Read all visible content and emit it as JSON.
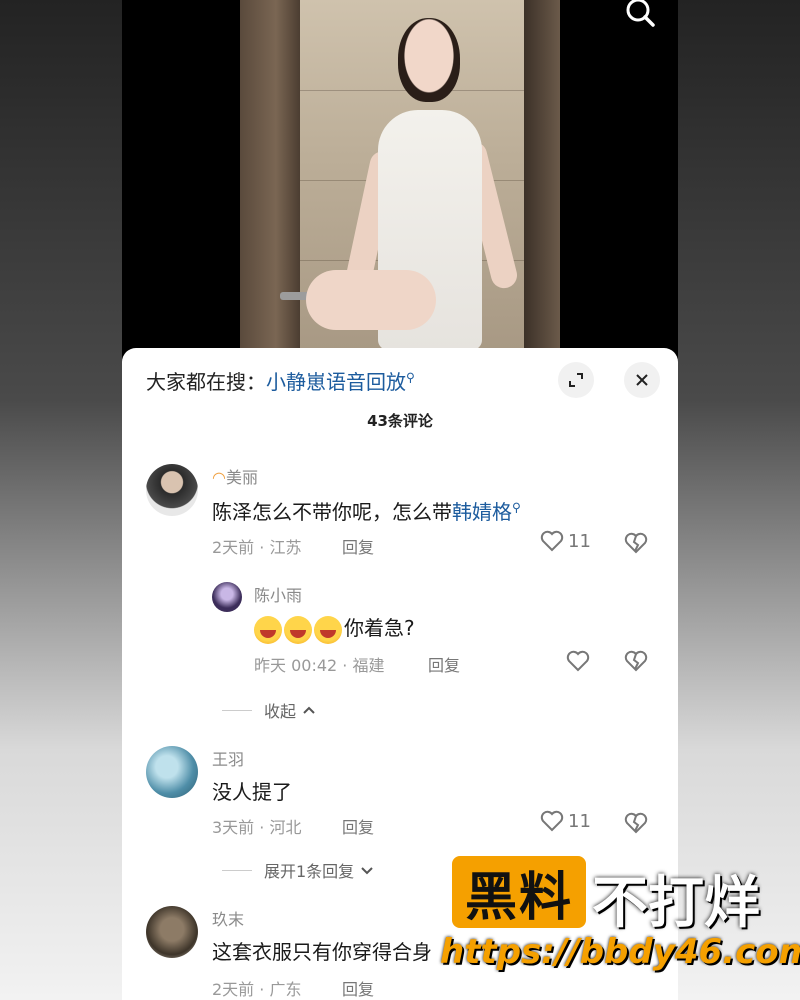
{
  "search_bar": {
    "prefix": "大家都在搜：",
    "term": "小静崽语音回放",
    "term_icon": "search-small-icon"
  },
  "comments_count": "43条评论",
  "comments": [
    {
      "name": "美丽",
      "name_prefix_icon": "rainbow-icon",
      "text_plain": "陈泽怎么不带你呢，怎么带",
      "text_keyword": "韩婧格",
      "time": "2天前 · 江苏",
      "reply_label": "回复",
      "likes": "11"
    },
    {
      "name": "陈小雨",
      "text": "你着急?",
      "emoji_count": 3,
      "time": "昨天 00:42 · 福建",
      "reply_label": "回复"
    },
    {
      "name": "王羽",
      "text": "没人提了",
      "time": "3天前 · 河北",
      "reply_label": "回复",
      "likes": "11"
    },
    {
      "name": "玖末",
      "text": "这套衣服只有你穿得合身",
      "time": "2天前 · 广东",
      "reply_label": "回复"
    }
  ],
  "collapse_label": "收起",
  "expand_label": "展开1条回复",
  "watermark": {
    "box_text": "黑料",
    "text": "不打烊",
    "url": "https://bbdy46.com"
  },
  "colors": {
    "keyword": "#1d5c9e",
    "watermark_orange": "#f5a000"
  }
}
